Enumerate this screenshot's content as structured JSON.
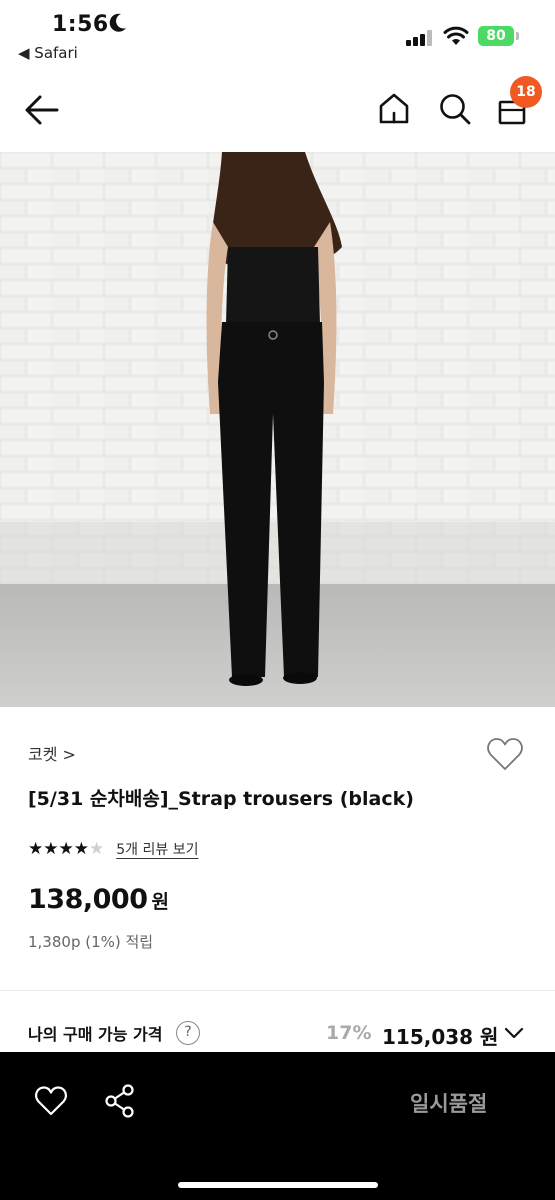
{
  "status_bar": {
    "time": "1:56",
    "back_app": "◀ Safari",
    "battery": "80"
  },
  "nav": {
    "cart_count": "18"
  },
  "product": {
    "brand": "코켓 >",
    "title": "[5/31 순차배송]_Strap trousers (black)",
    "rating": 4,
    "rating_max": 5,
    "review_link": "5개 리뷰 보기",
    "price": "138,000",
    "price_unit": "원",
    "points": "1,380p (1%) 적립"
  },
  "my_price": {
    "label": "나의 구매 가능 가격",
    "help": "?",
    "discount_rate": "17%",
    "price": "115,038 원"
  },
  "bottom_bar": {
    "soldout_label": "일시품절"
  },
  "icons": {
    "back": "back-arrow-icon",
    "home": "home-icon",
    "search": "search-icon",
    "cart": "cart-icon",
    "wish": "heart-icon",
    "share": "share-icon"
  },
  "colors": {
    "badge": "#f05a22",
    "battery": "#4cd964",
    "bottom_bar": "#000000",
    "soldout_text": "#9a9a9a"
  }
}
